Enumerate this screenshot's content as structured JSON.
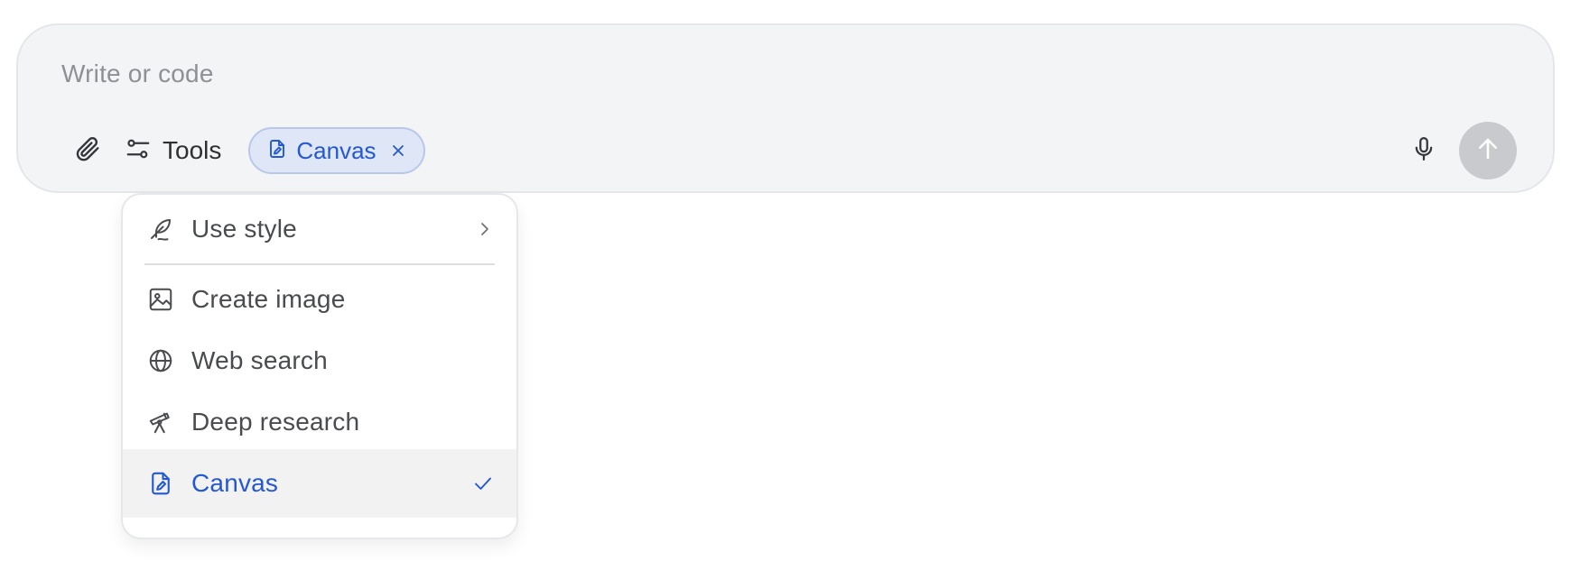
{
  "composer": {
    "placeholder": "Write or code",
    "tools_label": "Tools",
    "active_tool_chip": "Canvas"
  },
  "dropdown": {
    "items": [
      {
        "label": "Use style",
        "icon": "feather-icon",
        "trailing": "chevron-right-icon"
      },
      {
        "label": "Create image",
        "icon": "image-icon"
      },
      {
        "label": "Web search",
        "icon": "globe-icon"
      },
      {
        "label": "Deep research",
        "icon": "telescope-icon"
      },
      {
        "label": "Canvas",
        "icon": "canvas-file-icon",
        "trailing": "check-icon",
        "selected": true
      }
    ]
  },
  "colors": {
    "accent": "#2458d3",
    "composer_bg": "#f3f4f6",
    "chip_bg": "#dfe6f6",
    "send_button_disabled": "#c8cacd"
  }
}
